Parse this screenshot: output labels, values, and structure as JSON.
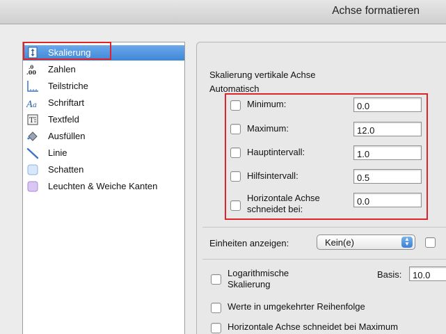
{
  "window": {
    "title": "Achse formatieren"
  },
  "sidebar": {
    "items": [
      {
        "label": "Skalierung",
        "icon": "scaling-icon",
        "selected": true
      },
      {
        "label": "Zahlen",
        "icon": "number-format-icon"
      },
      {
        "label": "Teilstriche",
        "icon": "tick-marks-icon"
      },
      {
        "label": "Schriftart",
        "icon": "font-icon"
      },
      {
        "label": "Textfeld",
        "icon": "textbox-icon"
      },
      {
        "label": "Ausfüllen",
        "icon": "fill-bucket-icon"
      },
      {
        "label": "Linie",
        "icon": "line-icon"
      },
      {
        "label": "Schatten",
        "icon": "shadow-icon"
      },
      {
        "label": "Leuchten & Weiche Kanten",
        "icon": "glow-icon"
      }
    ]
  },
  "scaling": {
    "section_title": "Skalierung vertikale Achse",
    "auto_label": "Automatisch",
    "fields": [
      {
        "label": "Minimum:",
        "value": "0.0",
        "checked": false
      },
      {
        "label": "Maximum:",
        "value": "12.0",
        "checked": false
      },
      {
        "label": "Hauptintervall:",
        "value": "1.0",
        "checked": false
      },
      {
        "label": "Hilfsintervall:",
        "value": "0.5",
        "checked": false
      },
      {
        "label_line1": "Horizontale Achse",
        "label_line2": "schneidet bei:",
        "value": "0.0",
        "checked": false
      }
    ]
  },
  "units": {
    "label": "Einheiten anzeigen:",
    "value": "Kein(e)"
  },
  "options": {
    "log_line1": "Logarithmische",
    "log_line2": "Skalierung",
    "basis_label": "Basis:",
    "basis_value": "10.0",
    "reverse_order": "Werte in umgekehrter Reihenfolge",
    "cross_at_max": "Horizontale Achse schneidet bei Maximum"
  },
  "colors": {
    "selection": "#3f86d8",
    "highlight": "#e0222b"
  }
}
